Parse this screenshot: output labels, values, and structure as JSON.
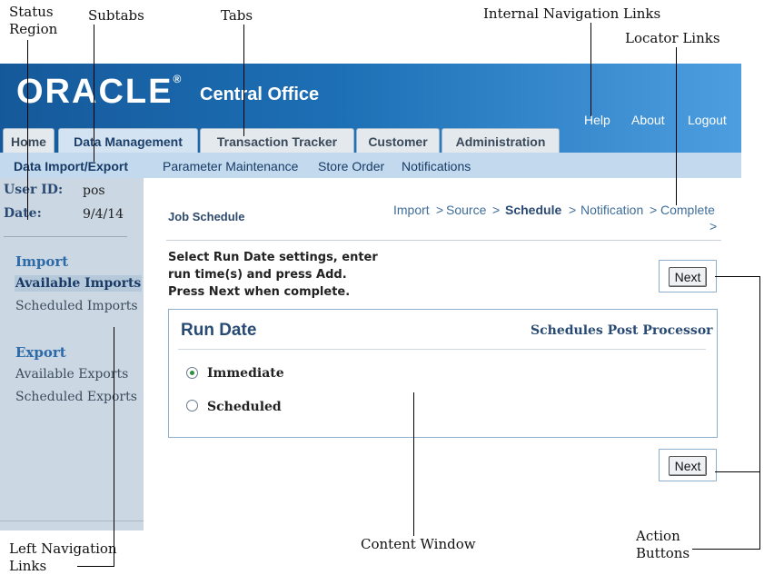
{
  "callouts": {
    "status_region_line1": "Status",
    "status_region_line2": "Region",
    "subtabs": "Subtabs",
    "tabs": "Tabs",
    "internal_nav": "Internal Navigation Links",
    "locator_links": "Locator Links",
    "left_nav_line1": "Left Navigation",
    "left_nav_line2": "Links",
    "content_window": "Content Window",
    "action_buttons_line1": "Action",
    "action_buttons_line2": "Buttons"
  },
  "header": {
    "logo": "ORACLE",
    "trademark": "®",
    "app_title": "Central Office",
    "global_links": [
      "Help",
      "About",
      "Logout"
    ]
  },
  "tabs": [
    "Home",
    "Data Management",
    "Transaction Tracker",
    "Customer",
    "Administration"
  ],
  "subtabs": [
    "Data Import/Export",
    "Parameter Maintenance",
    "Store Order",
    "Notifications"
  ],
  "status": {
    "user_label": "User ID:",
    "user_value": "pos",
    "date_label": "Date:",
    "date_value": "9/4/14"
  },
  "leftnav": {
    "import_heading": "Import",
    "import_items": [
      "Available Imports",
      "Scheduled Imports"
    ],
    "export_heading": "Export",
    "export_items": [
      "Available Exports",
      "Scheduled Exports"
    ]
  },
  "content": {
    "page_title": "Job Schedule",
    "locator": [
      "Import",
      "Source",
      "Schedule",
      "Notification",
      "Complete"
    ],
    "separator": ">",
    "instructions": [
      "Select Run Date settings, enter",
      "run time(s) and press Add.",
      "Press Next when complete."
    ],
    "next_label": "Next",
    "panel_title": "Run Date",
    "panel_right": "Schedules Post Processor",
    "options": [
      "Immediate",
      "Scheduled"
    ],
    "selected": "Immediate"
  }
}
